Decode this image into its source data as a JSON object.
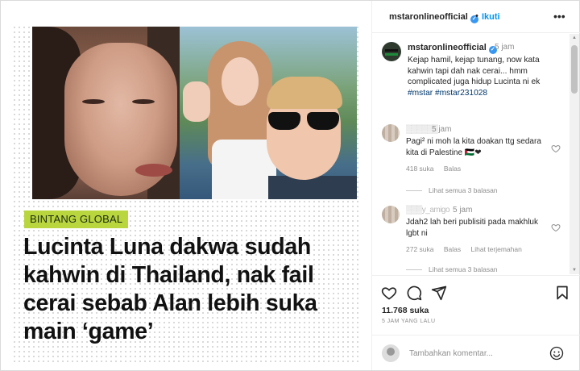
{
  "post": {
    "tag_label": "BINTANG GLOBAL",
    "headline": "Lucinta Luna dakwa sudah kahwin di Thailand, nak fail cerai sebab Alan lebih suka main ‘game’"
  },
  "header": {
    "username": "mstaronlineofficial",
    "separator": "•",
    "follow_label": "Ikuti",
    "more_label": "•••"
  },
  "caption": {
    "username": "mstaronlineofficial",
    "time": "5 jam",
    "text": "Kejap hamil, kejap tunang, now kata kahwin tapi dah nak cerai... hmm complicated juga hidup Lucinta ni ek",
    "hashtags": "#mstar #mstar231028"
  },
  "comments": [
    {
      "username": "▒▒▒▒▒▒",
      "time": "5 jam",
      "text": "Pagi² ni moh la kita doakan ttg sedara kita di Palestine 🇵🇸❤",
      "likes": "418 suka",
      "reply_label": "Balas",
      "translate_label": "",
      "view_replies": "Lihat semua 3 balasan"
    },
    {
      "username": "▒▒▒y_amigo",
      "time": "5 jam",
      "text": "Jdah2 lah beri publisiti pada makhluk lgbt ni",
      "likes": "272 suka",
      "reply_label": "Balas",
      "translate_label": "Lihat terjemahan",
      "view_replies": "Lihat semua 3 balasan"
    }
  ],
  "stats": {
    "likes": "11.768 suka",
    "date": "5 JAM YANG LALU"
  },
  "comment_input": {
    "placeholder": "Tambahkan komentar..."
  },
  "colors": {
    "tag_bg": "#b9d63f",
    "link": "#0095f6",
    "hashtag": "#00376b",
    "verified": "#3897f0"
  }
}
